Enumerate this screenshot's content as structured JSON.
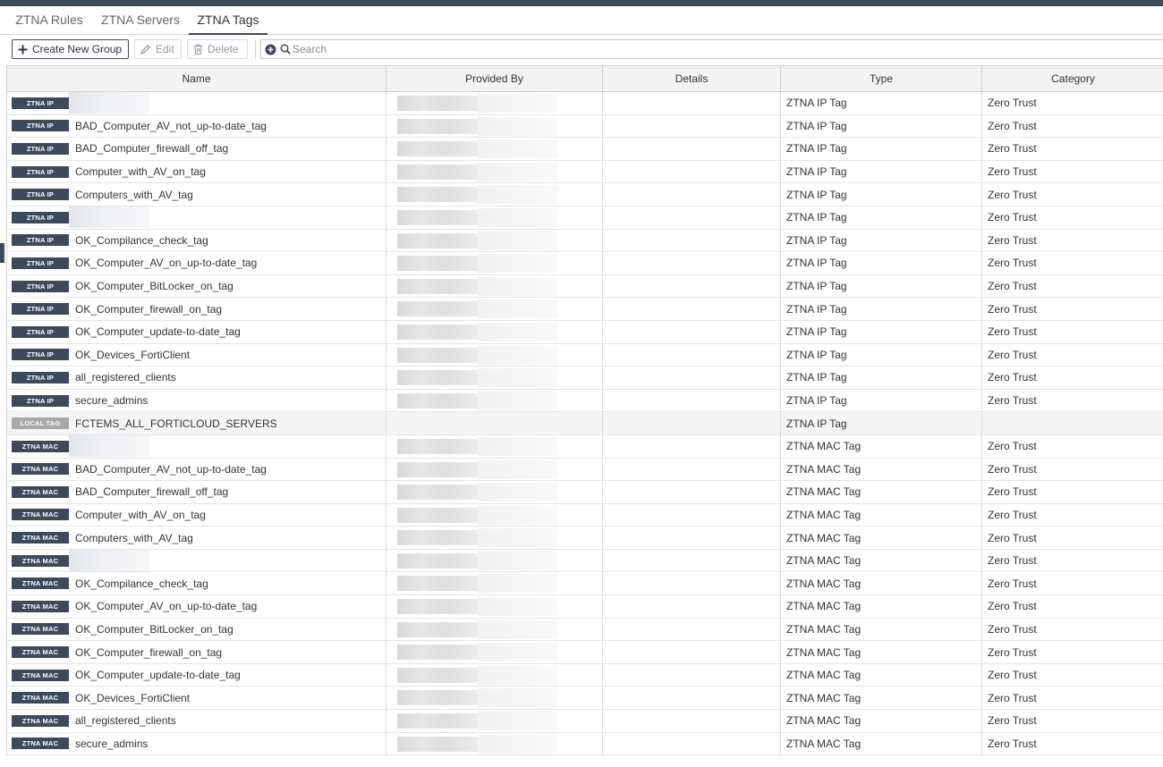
{
  "tabs": [
    "ZTNA Rules",
    "ZTNA Servers",
    "ZTNA Tags"
  ],
  "active_tab": "ZTNA Tags",
  "toolbar": {
    "create_label": "Create New Group",
    "edit_label": "Edit",
    "delete_label": "Delete",
    "search_placeholder": "Search"
  },
  "columns": [
    "Name",
    "Provided By",
    "Details",
    "Type",
    "Category"
  ],
  "colors": {
    "badge": "#3d4a5c",
    "badge_local": "#a8a8a8",
    "topbar": "#3d4a5c"
  },
  "rows": [
    {
      "badge": "ZTNA IP",
      "name": "",
      "redacted": true,
      "type": "ZTNA IP Tag",
      "category": "Zero Trust"
    },
    {
      "badge": "ZTNA IP",
      "name": "BAD_Computer_AV_not_up-to-date_tag",
      "type": "ZTNA IP Tag",
      "category": "Zero Trust"
    },
    {
      "badge": "ZTNA IP",
      "name": "BAD_Computer_firewall_off_tag",
      "type": "ZTNA IP Tag",
      "category": "Zero Trust"
    },
    {
      "badge": "ZTNA IP",
      "name": "Computer_with_AV_on_tag",
      "type": "ZTNA IP Tag",
      "category": "Zero Trust"
    },
    {
      "badge": "ZTNA IP",
      "name": "Computers_with_AV_tag",
      "type": "ZTNA IP Tag",
      "category": "Zero Trust"
    },
    {
      "badge": "ZTNA IP",
      "name": "",
      "redacted": true,
      "type": "ZTNA IP Tag",
      "category": "Zero Trust"
    },
    {
      "badge": "ZTNA IP",
      "name": "OK_Compilance_check_tag",
      "type": "ZTNA IP Tag",
      "category": "Zero Trust"
    },
    {
      "badge": "ZTNA IP",
      "name": "OK_Computer_AV_on_up-to-date_tag",
      "type": "ZTNA IP Tag",
      "category": "Zero Trust"
    },
    {
      "badge": "ZTNA IP",
      "name": "OK_Computer_BitLocker_on_tag",
      "type": "ZTNA IP Tag",
      "category": "Zero Trust"
    },
    {
      "badge": "ZTNA IP",
      "name": "OK_Computer_firewall_on_tag",
      "type": "ZTNA IP Tag",
      "category": "Zero Trust"
    },
    {
      "badge": "ZTNA IP",
      "name": "OK_Computer_update-to-date_tag",
      "type": "ZTNA IP Tag",
      "category": "Zero Trust"
    },
    {
      "badge": "ZTNA IP",
      "name": "OK_Devices_FortiClient",
      "type": "ZTNA IP Tag",
      "category": "Zero Trust"
    },
    {
      "badge": "ZTNA IP",
      "name": "all_registered_clients",
      "type": "ZTNA IP Tag",
      "category": "Zero Trust"
    },
    {
      "badge": "ZTNA IP",
      "name": "secure_admins",
      "type": "ZTNA IP Tag",
      "category": "Zero Trust"
    },
    {
      "badge": "LOCAL TAG",
      "name": "FCTEMS_ALL_FORTICLOUD_SERVERS",
      "type": "ZTNA IP Tag",
      "category": "",
      "local": true
    },
    {
      "badge": "ZTNA MAC",
      "name": "",
      "redacted": true,
      "type": "ZTNA MAC Tag",
      "category": "Zero Trust"
    },
    {
      "badge": "ZTNA MAC",
      "name": "BAD_Computer_AV_not_up-to-date_tag",
      "type": "ZTNA MAC Tag",
      "category": "Zero Trust"
    },
    {
      "badge": "ZTNA MAC",
      "name": "BAD_Computer_firewall_off_tag",
      "type": "ZTNA MAC Tag",
      "category": "Zero Trust"
    },
    {
      "badge": "ZTNA MAC",
      "name": "Computer_with_AV_on_tag",
      "type": "ZTNA MAC Tag",
      "category": "Zero Trust"
    },
    {
      "badge": "ZTNA MAC",
      "name": "Computers_with_AV_tag",
      "type": "ZTNA MAC Tag",
      "category": "Zero Trust"
    },
    {
      "badge": "ZTNA MAC",
      "name": "",
      "redacted": true,
      "type": "ZTNA MAC Tag",
      "category": "Zero Trust"
    },
    {
      "badge": "ZTNA MAC",
      "name": "OK_Compilance_check_tag",
      "type": "ZTNA MAC Tag",
      "category": "Zero Trust"
    },
    {
      "badge": "ZTNA MAC",
      "name": "OK_Computer_AV_on_up-to-date_tag",
      "type": "ZTNA MAC Tag",
      "category": "Zero Trust"
    },
    {
      "badge": "ZTNA MAC",
      "name": "OK_Computer_BitLocker_on_tag",
      "type": "ZTNA MAC Tag",
      "category": "Zero Trust"
    },
    {
      "badge": "ZTNA MAC",
      "name": "OK_Computer_firewall_on_tag",
      "type": "ZTNA MAC Tag",
      "category": "Zero Trust"
    },
    {
      "badge": "ZTNA MAC",
      "name": "OK_Computer_update-to-date_tag",
      "type": "ZTNA MAC Tag",
      "category": "Zero Trust"
    },
    {
      "badge": "ZTNA MAC",
      "name": "OK_Devices_FortiClient",
      "type": "ZTNA MAC Tag",
      "category": "Zero Trust"
    },
    {
      "badge": "ZTNA MAC",
      "name": "all_registered_clients",
      "type": "ZTNA MAC Tag",
      "category": "Zero Trust"
    },
    {
      "badge": "ZTNA MAC",
      "name": "secure_admins",
      "type": "ZTNA MAC Tag",
      "category": "Zero Trust"
    }
  ]
}
